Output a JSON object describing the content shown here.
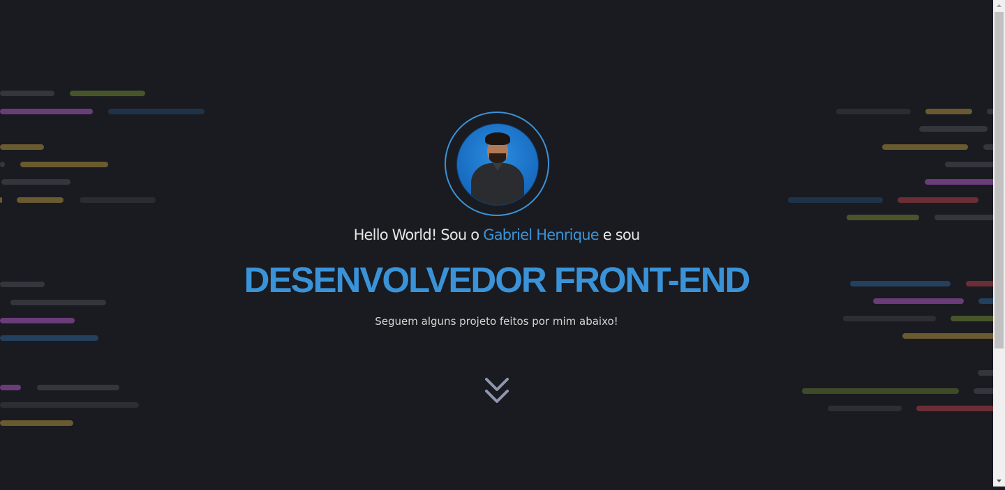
{
  "hero": {
    "greeting_prefix": "Hello World! Sou o ",
    "name": "Gabriel Henrique",
    "greeting_suffix": " e sou",
    "title": "DESENVOLVEDOR FRONT-END",
    "subtitle": "Seguem alguns projeto feitos por mim abaixo!",
    "scroll_icon": "double-chevron-down-icon"
  },
  "avatar": {
    "alt": "Gabriel Henrique"
  },
  "colors": {
    "background": "#1a1b20",
    "accent": "#3a93d8",
    "text": "#e6e6e6",
    "code_line_colors": [
      "#3a3d44",
      "#4d5a2e",
      "#6b3c7a",
      "#233a52",
      "#6b5a30",
      "#2c2e33",
      "#6b2e36"
    ]
  }
}
